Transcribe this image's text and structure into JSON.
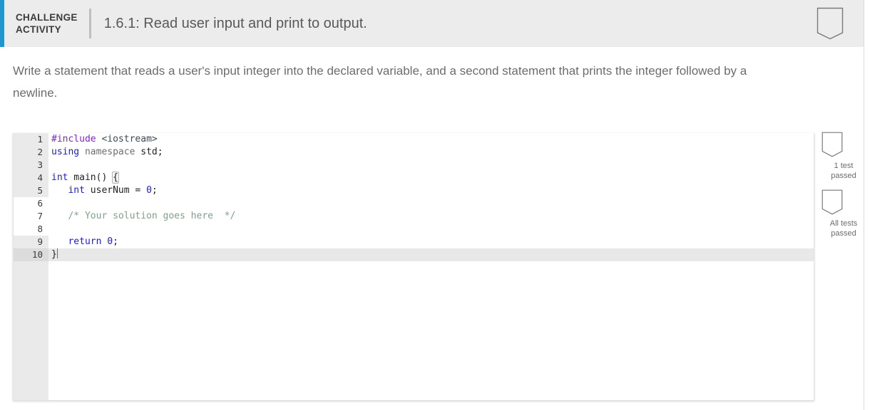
{
  "header": {
    "kicker_line1": "CHALLENGE",
    "kicker_line2": "ACTIVITY",
    "title": "1.6.1: Read user input and print to output.",
    "accent_color": "#1f96cd",
    "background_color": "#ececec",
    "badge_icon": "pennant-icon"
  },
  "prompt": {
    "text": "Write a statement that reads a user's input integer into the declared variable, and a second statement that prints the integer followed by a newline."
  },
  "editor": {
    "language": "cpp",
    "active_line": 10,
    "editable_lines": [
      6,
      7,
      8
    ],
    "caret_line": 10,
    "lines": [
      {
        "n": "1",
        "tokens": [
          {
            "t": "#include",
            "c": "tok-pre"
          },
          {
            "t": " ",
            "c": "tok-plain"
          },
          {
            "t": "<iostream>",
            "c": "tok-hdr"
          }
        ]
      },
      {
        "n": "2",
        "tokens": [
          {
            "t": "using",
            "c": "tok-kw"
          },
          {
            "t": " ",
            "c": "tok-plain"
          },
          {
            "t": "namespace",
            "c": "tok-ns"
          },
          {
            "t": " ",
            "c": "tok-plain"
          },
          {
            "t": "std;",
            "c": "tok-plain"
          }
        ]
      },
      {
        "n": "3",
        "tokens": []
      },
      {
        "n": "4",
        "tokens": [
          {
            "t": "int",
            "c": "tok-kw"
          },
          {
            "t": " main() ",
            "c": "tok-plain"
          },
          {
            "t": "{",
            "c": "tok-plain bracket-match"
          }
        ]
      },
      {
        "n": "5",
        "tokens": [
          {
            "t": "   ",
            "c": "tok-plain"
          },
          {
            "t": "int",
            "c": "tok-kw"
          },
          {
            "t": " userNum ",
            "c": "tok-id"
          },
          {
            "t": "= ",
            "c": "tok-plain"
          },
          {
            "t": "0",
            "c": "tok-num"
          },
          {
            "t": ";",
            "c": "tok-plain"
          }
        ]
      },
      {
        "n": "6",
        "tokens": []
      },
      {
        "n": "7",
        "tokens": [
          {
            "t": "   /* Your solution goes here  */",
            "c": "tok-cmt"
          }
        ]
      },
      {
        "n": "8",
        "tokens": []
      },
      {
        "n": "9",
        "tokens": [
          {
            "t": "   ",
            "c": "tok-plain"
          },
          {
            "t": "return",
            "c": "tok-kw"
          },
          {
            "t": " ",
            "c": "tok-plain"
          },
          {
            "t": "0",
            "c": "tok-num"
          },
          {
            "t": ";",
            "c": "tok-plain"
          }
        ]
      },
      {
        "n": "10",
        "tokens": [
          {
            "t": "}",
            "c": "tok-plain"
          }
        ]
      }
    ]
  },
  "test_rail": {
    "items": [
      {
        "icon": "pennant-icon",
        "caption_line1": "1 test",
        "caption_line2": "passed"
      },
      {
        "icon": "pennant-icon",
        "caption_line1": "All tests",
        "caption_line2": "passed"
      }
    ]
  }
}
